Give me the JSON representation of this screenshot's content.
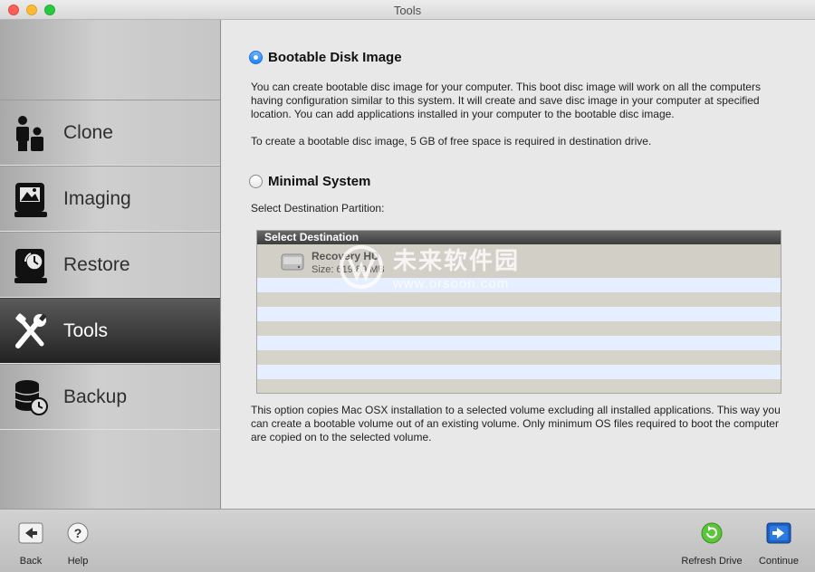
{
  "window": {
    "title": "Tools"
  },
  "sidebar": {
    "items": [
      {
        "label": "Clone",
        "icon": "clone-icon",
        "active": false
      },
      {
        "label": "Imaging",
        "icon": "imaging-icon",
        "active": false
      },
      {
        "label": "Restore",
        "icon": "restore-icon",
        "active": false
      },
      {
        "label": "Tools",
        "icon": "tools-icon",
        "active": true
      },
      {
        "label": "Backup",
        "icon": "backup-icon",
        "active": false
      }
    ]
  },
  "content": {
    "option1": {
      "label": "Bootable Disk Image",
      "selected": true,
      "desc1": "You can create bootable disc image for your computer. This boot disc image will work on all the computers having configuration similar to this system.  It will create and save disc image in  your computer at specified location. You can add applications installed in your computer to the bootable disc image.",
      "desc2": "To create a bootable disc image, 5 GB of free space is required in destination drive."
    },
    "option2": {
      "label": "Minimal System",
      "selected": false
    },
    "destination_prompt": "Select Destination Partition:",
    "destination": {
      "header": "Select Destination",
      "drives": [
        {
          "name": "Recovery HD",
          "size": "Size: 619.89 MB"
        }
      ]
    },
    "footer_desc": "This option copies Mac OSX installation to a selected volume excluding all installed applications. This way you can create a bootable volume out  of an existing volume. Only minimum OS files required to boot the computer are copied on to the selected volume."
  },
  "watermark": {
    "text_cn": "未来软件园",
    "url": "www.orsoon.com"
  },
  "bottombar": {
    "back_label": "Back",
    "help_label": "Help",
    "refresh_label": "Refresh Drive",
    "continue_label": "Continue"
  },
  "colors": {
    "accent": "#1a82fb",
    "row_odd": "#d6d3cb",
    "row_even": "#e6efff",
    "active_nav": "#2a2a2a"
  }
}
